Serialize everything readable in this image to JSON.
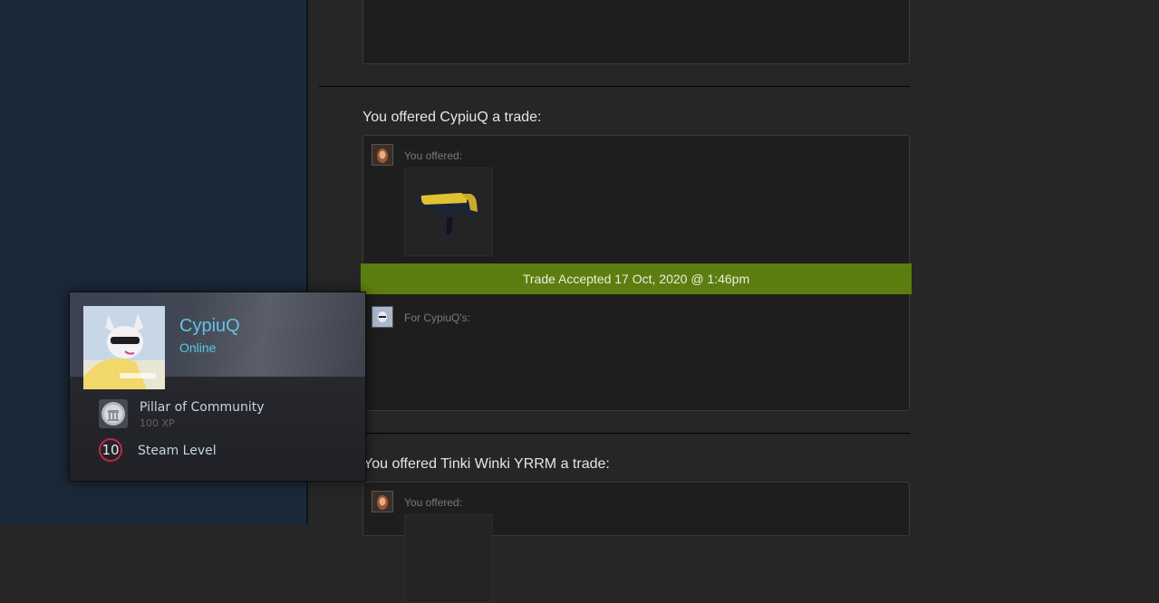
{
  "trades": [
    {
      "heading": "You offered CypiuQ a trade:",
      "you_offered_label": "You offered:",
      "item_icon": "pistol-weapon-icon",
      "status": "Trade Accepted 17 Oct, 2020 @ 1:46pm",
      "for_label": "For CypiuQ's:"
    },
    {
      "heading": "You offered Tinki Winki YRRM a trade:",
      "you_offered_label": "You offered:"
    }
  ],
  "profile_card": {
    "name": "CypiuQ",
    "status": "Online",
    "badge_name": "Pillar of Community",
    "badge_xp": "100 XP",
    "badge_icon": "community-badge-icon",
    "level": "10",
    "level_label": "Steam Level"
  },
  "colors": {
    "accepted_bar": "#5c7e10",
    "name": "#5fc4e8",
    "online": "#57cbde",
    "level_ring": "#c02942"
  }
}
